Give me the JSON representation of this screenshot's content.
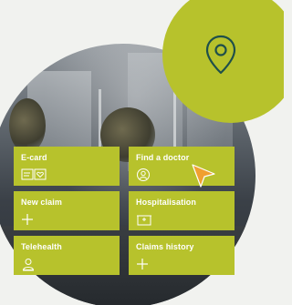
{
  "tiles": [
    {
      "label": "E-card",
      "icon": "id-card-icon"
    },
    {
      "label": "Find a doctor",
      "icon": "doctor-icon"
    },
    {
      "label": "New claim",
      "icon": "plus-icon"
    },
    {
      "label": "Hospitalisation",
      "icon": "hospital-icon"
    },
    {
      "label": "Telehealth",
      "icon": "telehealth-icon"
    },
    {
      "label": "Claims history",
      "icon": "plus-icon"
    }
  ],
  "colors": {
    "accent": "#b7c22c",
    "pin_stroke": "#1f4f4a",
    "cursor": "#f0a030",
    "background": "#f1f2ef"
  },
  "pin_icon": "location-pin-icon"
}
